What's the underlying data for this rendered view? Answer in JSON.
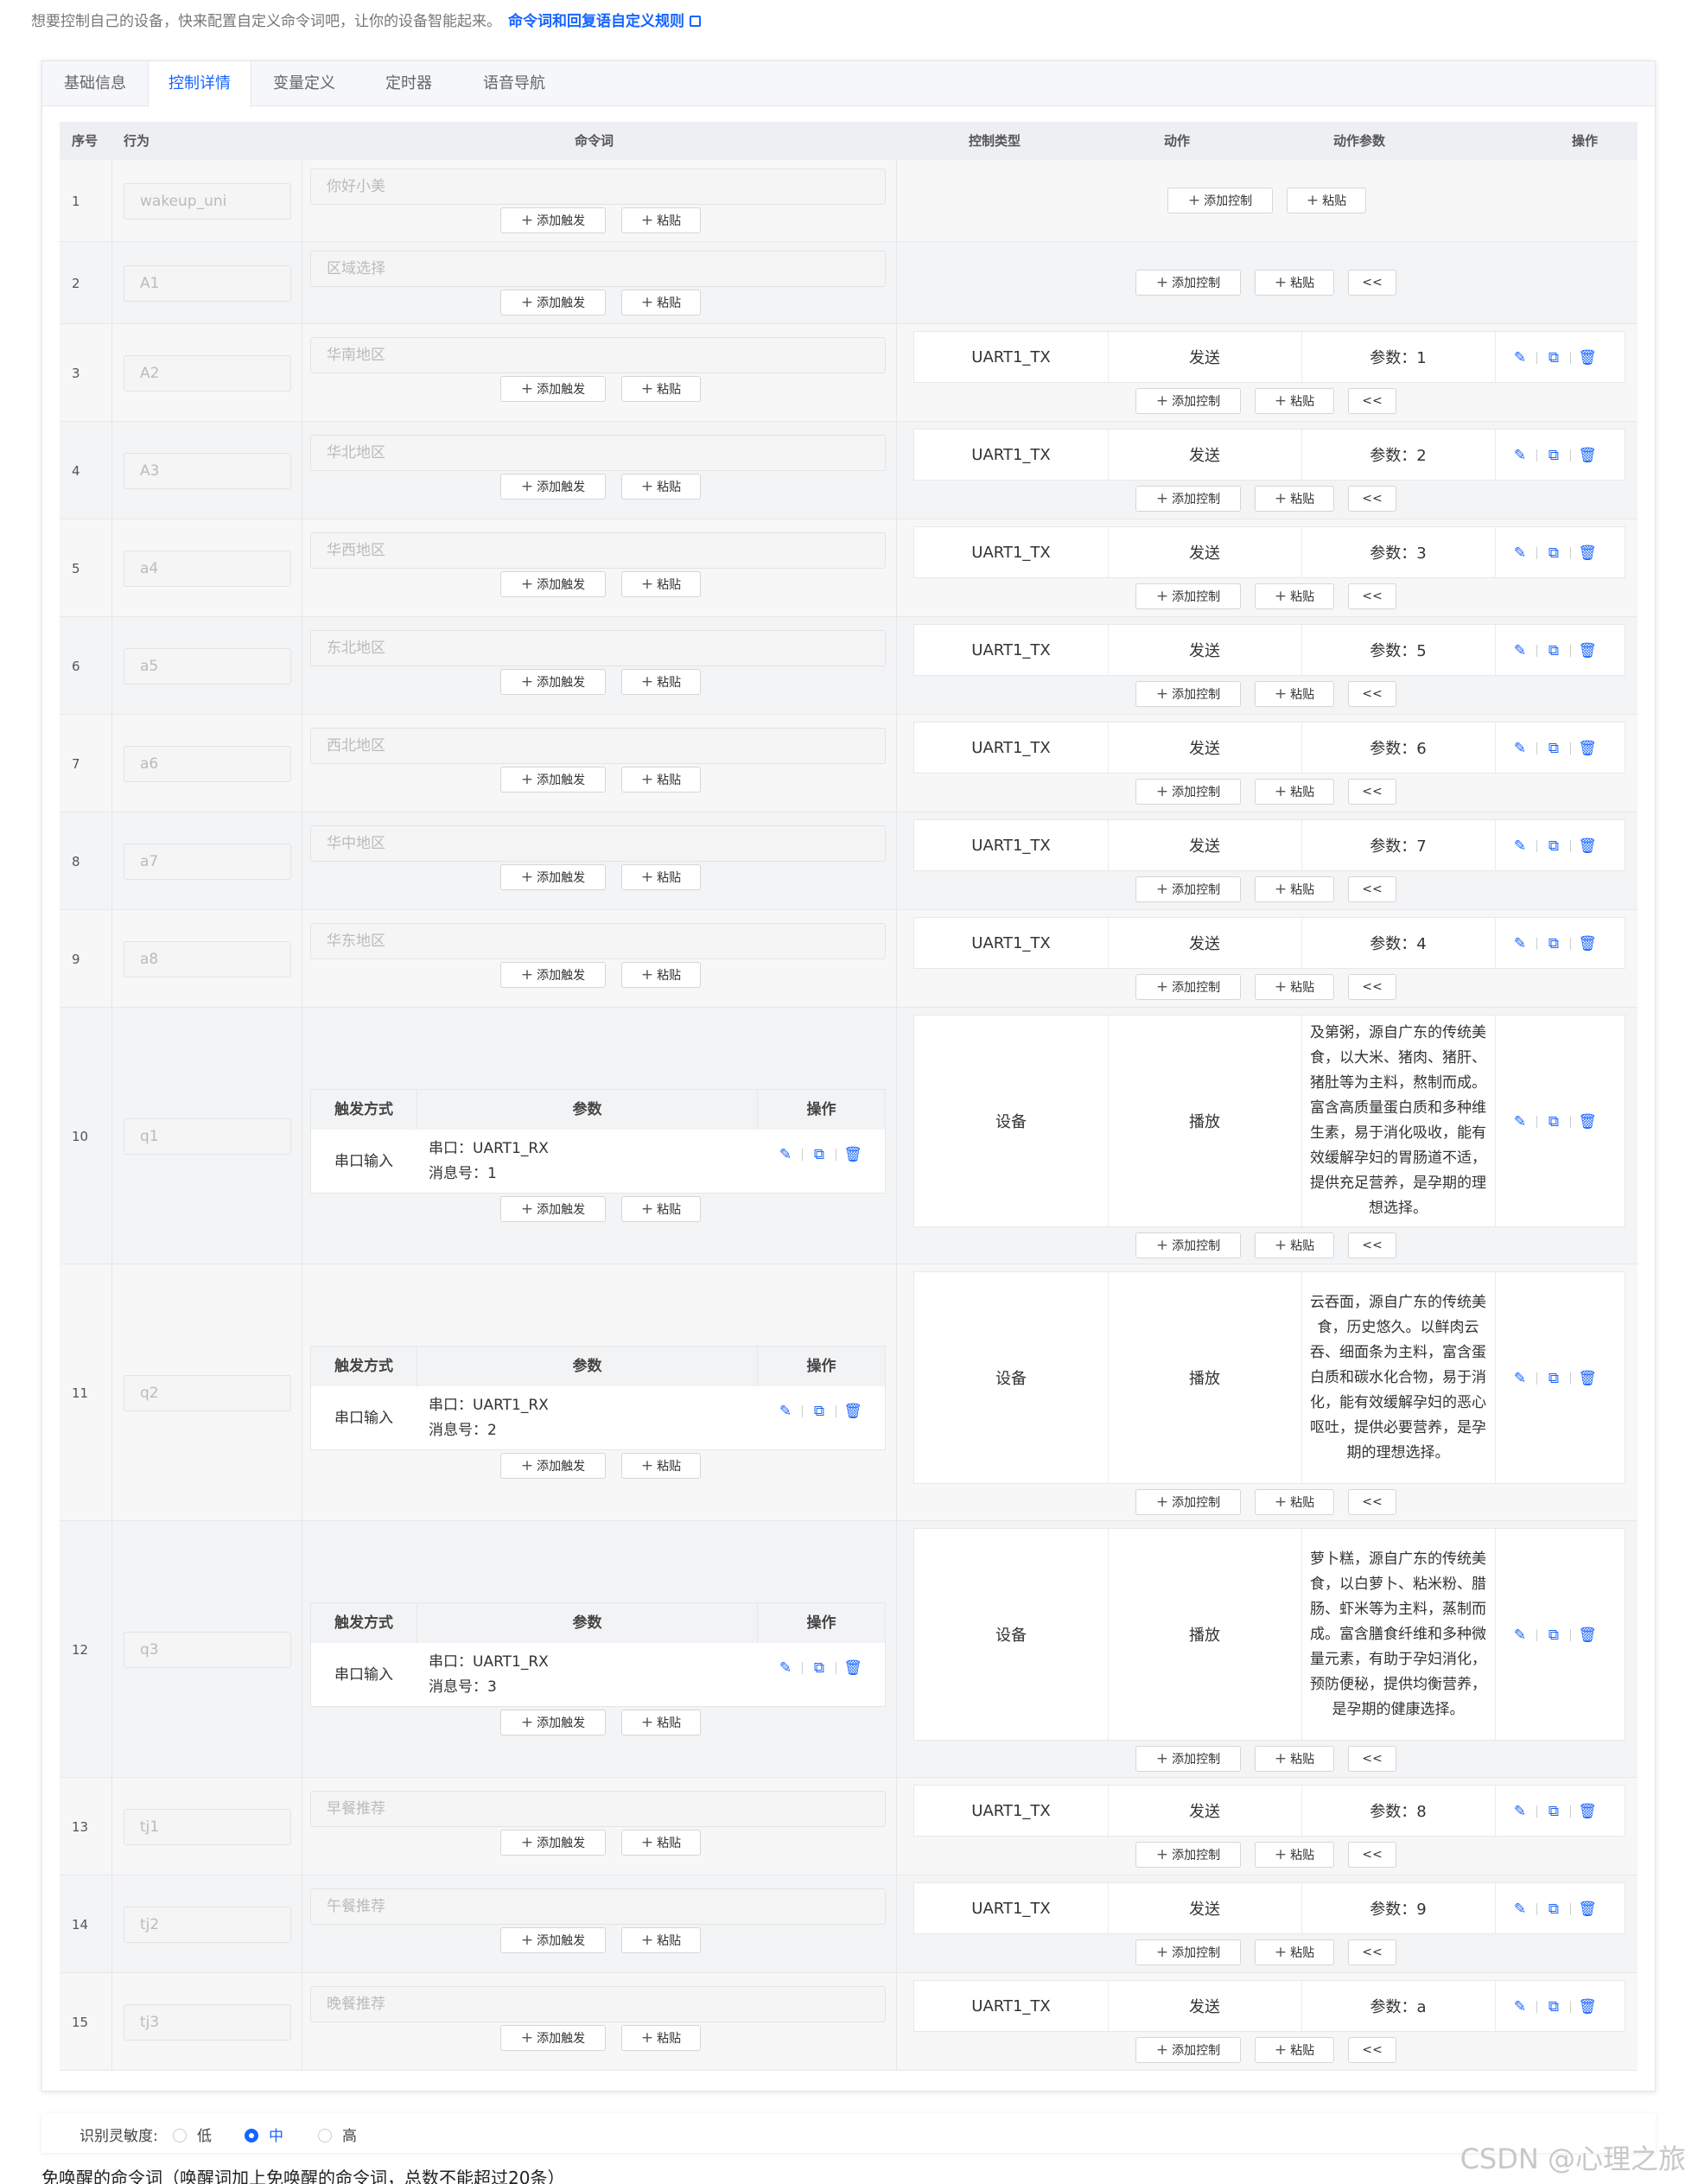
{
  "intro": {
    "text": "想要控制自己的设备，快来配置自定义命令词吧，让你的设备智能起来。",
    "link": "命令词和回复语自定义规则"
  },
  "tabs": [
    "基础信息",
    "控制详情",
    "变量定义",
    "定时器",
    "语音导航"
  ],
  "active_tab": 1,
  "headers": {
    "seq": "序号",
    "behavior": "行为",
    "command": "命令词",
    "control_type": "控制类型",
    "action": "动作",
    "action_param": "动作参数",
    "operation": "操作"
  },
  "buttons": {
    "add_trigger": "添加触发",
    "paste": "粘贴",
    "add_control": "添加控制",
    "collapse": "<<"
  },
  "trigger_headers": {
    "method": "触发方式",
    "param": "参数",
    "operation": "操作"
  },
  "rows": [
    {
      "seq": "1",
      "behavior": "wakeup_uni",
      "command": "你好小美"
    },
    {
      "seq": "2",
      "behavior": "A1",
      "command": "区域选择"
    },
    {
      "seq": "3",
      "behavior": "A2",
      "command": "华南地区",
      "ctype": "UART1_TX",
      "action": "发送",
      "param": "参数：1"
    },
    {
      "seq": "4",
      "behavior": "A3",
      "command": "华北地区",
      "ctype": "UART1_TX",
      "action": "发送",
      "param": "参数：2"
    },
    {
      "seq": "5",
      "behavior": "a4",
      "command": "华西地区",
      "ctype": "UART1_TX",
      "action": "发送",
      "param": "参数：3"
    },
    {
      "seq": "6",
      "behavior": "a5",
      "command": "东北地区",
      "ctype": "UART1_TX",
      "action": "发送",
      "param": "参数：5"
    },
    {
      "seq": "7",
      "behavior": "a6",
      "command": "西北地区",
      "ctype": "UART1_TX",
      "action": "发送",
      "param": "参数：6"
    },
    {
      "seq": "8",
      "behavior": "a7",
      "command": "华中地区",
      "ctype": "UART1_TX",
      "action": "发送",
      "param": "参数：7"
    },
    {
      "seq": "9",
      "behavior": "a8",
      "command": "华东地区",
      "ctype": "UART1_TX",
      "action": "发送",
      "param": "参数：4"
    },
    {
      "seq": "10",
      "behavior": "q1",
      "trigger": {
        "method": "串口输入",
        "param1": "串口：UART1_RX",
        "param2": "消息号：1"
      },
      "ctype": "设备",
      "action": "播放",
      "param": "及第粥，源自广东的传统美食，以大米、猪肉、猪肝、猪肚等为主料，熬制而成。富含高质量蛋白质和多种维生素，易于消化吸收，能有效缓解孕妇的胃肠道不适，提供充足营养，是孕期的理想选择。"
    },
    {
      "seq": "11",
      "behavior": "q2",
      "trigger": {
        "method": "串口输入",
        "param1": "串口：UART1_RX",
        "param2": "消息号：2"
      },
      "ctype": "设备",
      "action": "播放",
      "param": "云吞面，源自广东的传统美食，历史悠久。以鲜肉云吞、细面条为主料，富含蛋白质和碳水化合物，易于消化，能有效缓解孕妇的恶心呕吐，提供必要营养，是孕期的理想选择。"
    },
    {
      "seq": "12",
      "behavior": "q3",
      "trigger": {
        "method": "串口输入",
        "param1": "串口：UART1_RX",
        "param2": "消息号：3"
      },
      "ctype": "设备",
      "action": "播放",
      "param": "萝卜糕，源自广东的传统美食，以白萝卜、粘米粉、腊肠、虾米等为主料，蒸制而成。富含膳食纤维和多种微量元素，有助于孕妇消化，预防便秘，提供均衡营养，是孕期的健康选择。"
    },
    {
      "seq": "13",
      "behavior": "tj1",
      "command": "早餐推荐",
      "ctype": "UART1_TX",
      "action": "发送",
      "param": "参数：8"
    },
    {
      "seq": "14",
      "behavior": "tj2",
      "command": "午餐推荐",
      "ctype": "UART1_TX",
      "action": "发送",
      "param": "参数：9"
    },
    {
      "seq": "15",
      "behavior": "tj3",
      "command": "晚餐推荐",
      "ctype": "UART1_TX",
      "action": "发送",
      "param": "参数：a"
    }
  ],
  "sensitivity": {
    "label": "识别灵敏度:",
    "options": [
      "低",
      "中",
      "高"
    ],
    "selected": 1
  },
  "footer": "免唤醒的命令词（唤醒词加上免唤醒的命令词，总数不能超过20条）",
  "watermark": "CSDN @心理之旅",
  "colors": {
    "accent": "#1664ff",
    "header_bg": "#eeeff2"
  }
}
